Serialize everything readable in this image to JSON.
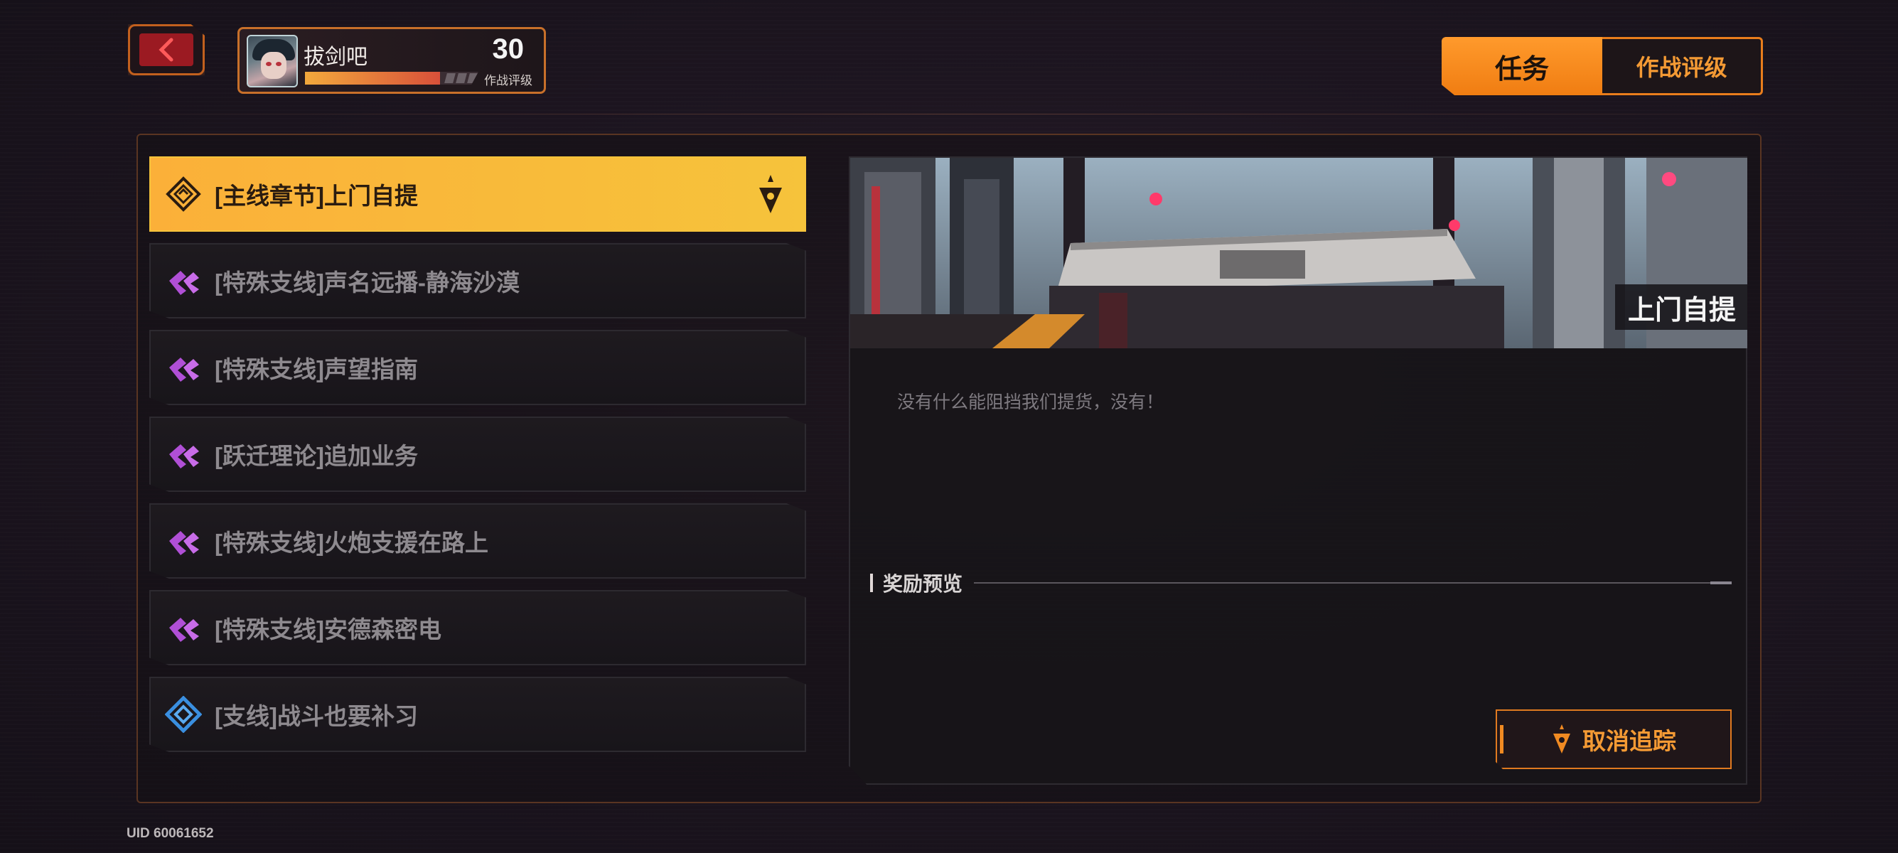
{
  "header": {
    "back_label": "",
    "profile": {
      "name": "拔剑吧",
      "level": "30",
      "level_label": "作战评级",
      "xp_progress": 0.78
    },
    "tabs": [
      {
        "label": "任务",
        "active": true
      },
      {
        "label": "作战评级",
        "active": false
      }
    ]
  },
  "quests": [
    {
      "label": "[主线章节]上门自提",
      "type": "main",
      "active": true,
      "tracked": true
    },
    {
      "label": "[特殊支线]声名远播-静海沙漠",
      "type": "special",
      "active": false
    },
    {
      "label": "[特殊支线]声望指南",
      "type": "special",
      "active": false
    },
    {
      "label": "[跃迁理论]追加业务",
      "type": "special",
      "active": false
    },
    {
      "label": "[特殊支线]火炮支援在路上",
      "type": "special",
      "active": false
    },
    {
      "label": "[特殊支线]安德森密电",
      "type": "special",
      "active": false
    },
    {
      "label": "[支线]战斗也要补习",
      "type": "side",
      "active": false
    }
  ],
  "detail": {
    "banner_title": "上门自提",
    "description": "没有什么能阻挡我们提货，没有！",
    "reward_title": "奖励预览",
    "cancel_label": "取消追踪"
  },
  "footer": {
    "uid": "UID 60061652"
  },
  "colors": {
    "accent": "#f08a22",
    "active_quest": "#f6c33b",
    "special_icon": "#b04fd6",
    "side_icon": "#3a8fe0"
  }
}
